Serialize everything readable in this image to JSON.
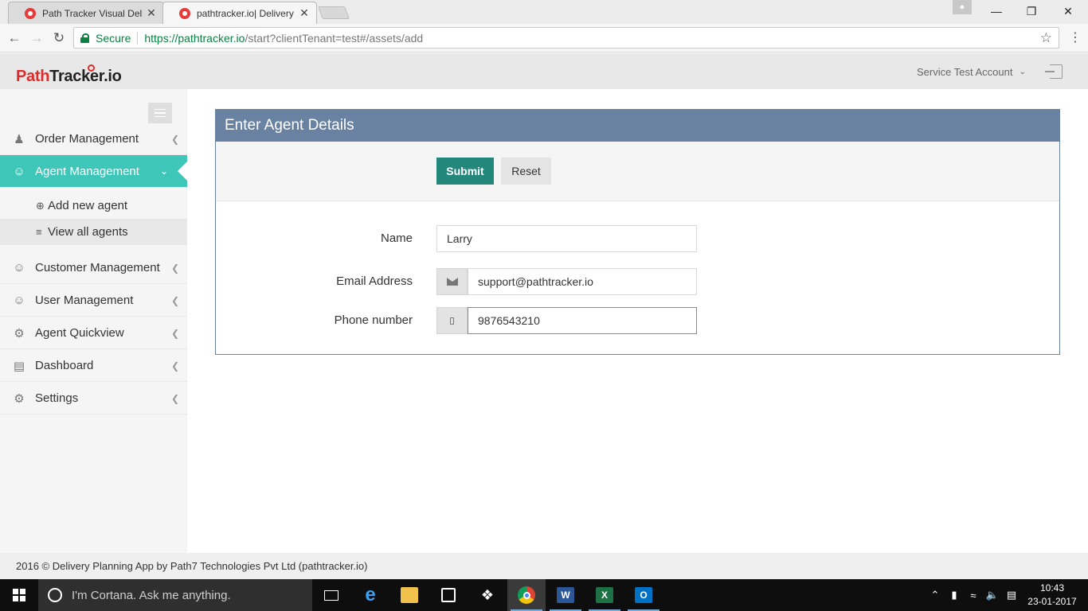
{
  "browser": {
    "tabs": [
      {
        "title": "Path Tracker Visual Delive",
        "close": "✕"
      },
      {
        "title": "pathtracker.io| Delivery P",
        "close": "✕"
      }
    ],
    "secure_label": "Secure",
    "url_host": "https://pathtracker.io",
    "url_path": "/start?clientTenant=test#/assets/add"
  },
  "header": {
    "logo_part1": "Path",
    "logo_part2": "Tracker.io",
    "account": "Service Test Account"
  },
  "sidebar": {
    "items": [
      {
        "label": "Order Management",
        "icon": "user-secret-icon"
      },
      {
        "label": "Agent Management",
        "icon": "users-icon"
      },
      {
        "label": "Customer Management",
        "icon": "user-icon"
      },
      {
        "label": "User Management",
        "icon": "user-icon"
      },
      {
        "label": "Agent Quickview",
        "icon": "motorcycle-icon"
      },
      {
        "label": "Dashboard",
        "icon": "bar-chart-icon"
      },
      {
        "label": "Settings",
        "icon": "gear-icon"
      }
    ],
    "subitems": [
      {
        "label": "Add new agent",
        "icon": "plus-circle-icon"
      },
      {
        "label": "View all agents",
        "icon": "list-icon"
      }
    ]
  },
  "panel": {
    "title": "Enter Agent Details",
    "submit": "Submit",
    "reset": "Reset",
    "fields": {
      "name_label": "Name",
      "name_value": "Larry",
      "email_label": "Email Address",
      "email_value": "support@pathtracker.io",
      "phone_label": "Phone number",
      "phone_value": "9876543210"
    }
  },
  "footer": {
    "text": "2016 © Delivery Planning App by Path7 Technologies Pvt Ltd (pathtracker.io)"
  },
  "taskbar": {
    "cortana": "I'm Cortana. Ask me anything.",
    "time": "10:43",
    "date": "23-01-2017"
  },
  "colors": {
    "accent": "#3ec6b8",
    "panel_header": "#6a82a2",
    "submit": "#24877b",
    "brand_red": "#e02b2b"
  }
}
